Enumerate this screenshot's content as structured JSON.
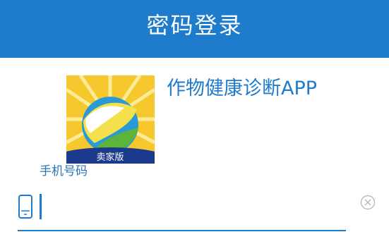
{
  "header": {
    "title": "密码登录"
  },
  "app": {
    "name": "作物健康诊断APP",
    "logo_badge": "卖家版"
  },
  "form": {
    "phone_label": "手机号码",
    "phone_value": "",
    "phone_placeholder": ""
  },
  "icons": {
    "phone": "mobile-phone-icon",
    "clear": "clear-circle-x-icon"
  },
  "colors": {
    "primary": "#1f7ccc",
    "header_bg": "#1f7ccc",
    "logo_bg": "#f6c82e",
    "logo_band": "#1b3a8c"
  }
}
